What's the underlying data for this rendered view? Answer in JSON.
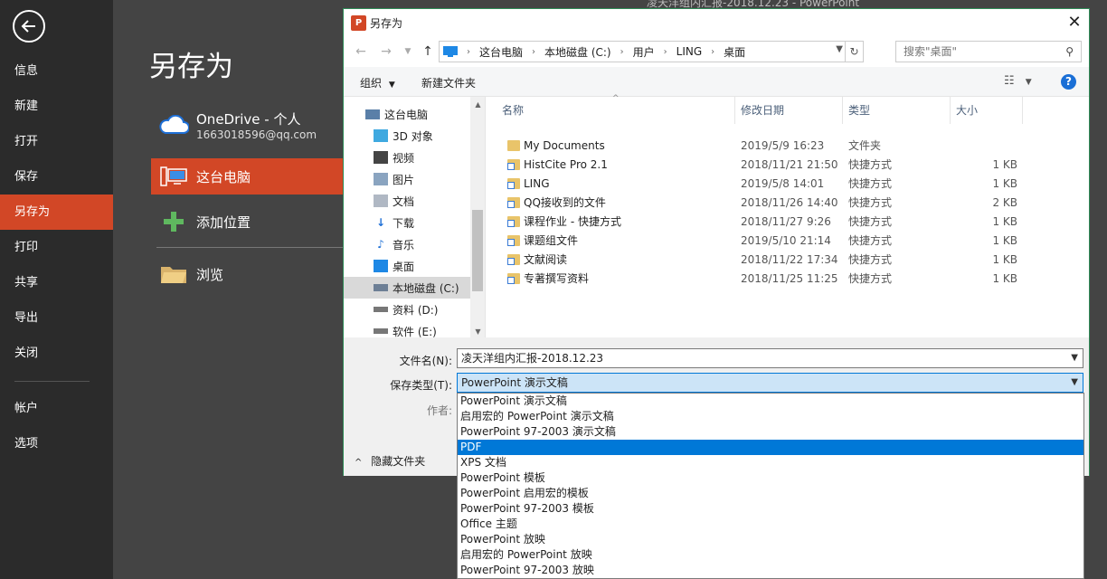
{
  "window_title": "凌天洋组内汇报-2018.12.23 - PowerPoint",
  "rail": {
    "items": [
      {
        "label": "信息"
      },
      {
        "label": "新建"
      },
      {
        "label": "打开"
      },
      {
        "label": "保存"
      },
      {
        "label": "另存为"
      },
      {
        "label": "打印"
      },
      {
        "label": "共享"
      },
      {
        "label": "导出"
      },
      {
        "label": "关闭"
      },
      {
        "label": "帐户"
      },
      {
        "label": "选项"
      }
    ],
    "active": "另存为"
  },
  "backstage": {
    "title": "另存为",
    "places": [
      {
        "label": "OneDrive - 个人",
        "sub": "1663018596@qq.com",
        "icon": "cloud-icon"
      },
      {
        "label": "这台电脑",
        "icon": "computer-icon"
      },
      {
        "label": "添加位置",
        "icon": "plus-icon"
      },
      {
        "label": "浏览",
        "icon": "folder-icon"
      }
    ]
  },
  "dialog": {
    "title": "另存为",
    "breadcrumb": [
      "这台电脑",
      "本地磁盘 (C:)",
      "用户",
      "LING",
      "桌面"
    ],
    "search_placeholder": "搜索\"桌面\"",
    "toolbar": {
      "organize": "组织",
      "new_folder": "新建文件夹"
    },
    "tree": [
      {
        "label": "这台电脑",
        "icon": "computer-icon"
      },
      {
        "label": "3D 对象",
        "icon": "cube-icon"
      },
      {
        "label": "视频",
        "icon": "video-icon"
      },
      {
        "label": "图片",
        "icon": "picture-icon"
      },
      {
        "label": "文档",
        "icon": "document-icon"
      },
      {
        "label": "下载",
        "icon": "download-icon"
      },
      {
        "label": "音乐",
        "icon": "music-icon"
      },
      {
        "label": "桌面",
        "icon": "desktop-icon"
      },
      {
        "label": "本地磁盘 (C:)",
        "icon": "drive-icon"
      },
      {
        "label": "资料 (D:)",
        "icon": "drive-icon"
      },
      {
        "label": "软件 (E:)",
        "icon": "drive-icon"
      }
    ],
    "columns": {
      "name": "名称",
      "date": "修改日期",
      "type": "类型",
      "size": "大小"
    },
    "files": [
      {
        "name": "My Documents",
        "date": "2019/5/9 16:23",
        "type": "文件夹",
        "size": "",
        "shortcut": false
      },
      {
        "name": "HistCite Pro 2.1",
        "date": "2018/11/21 21:50",
        "type": "快捷方式",
        "size": "1 KB",
        "shortcut": true
      },
      {
        "name": "LING",
        "date": "2019/5/8 14:01",
        "type": "快捷方式",
        "size": "1 KB",
        "shortcut": true
      },
      {
        "name": "QQ接收到的文件",
        "date": "2018/11/26 14:40",
        "type": "快捷方式",
        "size": "2 KB",
        "shortcut": true
      },
      {
        "name": "课程作业 - 快捷方式",
        "date": "2018/11/27 9:26",
        "type": "快捷方式",
        "size": "1 KB",
        "shortcut": true
      },
      {
        "name": "课题组文件",
        "date": "2019/5/10 21:14",
        "type": "快捷方式",
        "size": "1 KB",
        "shortcut": true
      },
      {
        "name": "文献阅读",
        "date": "2018/11/22 17:34",
        "type": "快捷方式",
        "size": "1 KB",
        "shortcut": true
      },
      {
        "name": "专著撰写资料",
        "date": "2018/11/25 11:25",
        "type": "快捷方式",
        "size": "1 KB",
        "shortcut": true
      }
    ],
    "form": {
      "filename_label": "文件名(N):",
      "filename_value": "凌天洋组内汇报-2018.12.23",
      "type_label": "保存类型(T):",
      "type_value": "PowerPoint 演示文稿",
      "author_label": "作者:",
      "hide_folders": "隐藏文件夹"
    },
    "type_options": [
      "PowerPoint 演示文稿",
      "启用宏的 PowerPoint 演示文稿",
      "PowerPoint 97-2003 演示文稿",
      "PDF",
      "XPS 文档",
      "PowerPoint 模板",
      "PowerPoint 启用宏的模板",
      "PowerPoint 97-2003 模板",
      "Office 主题",
      "PowerPoint 放映",
      "启用宏的 PowerPoint 放映",
      "PowerPoint 97-2003 放映"
    ],
    "highlighted_option": "PDF"
  },
  "colors": {
    "accent": "#d24726",
    "rail_bg": "#2b2b2b",
    "content_bg": "#444444",
    "selection": "#0078d7"
  }
}
